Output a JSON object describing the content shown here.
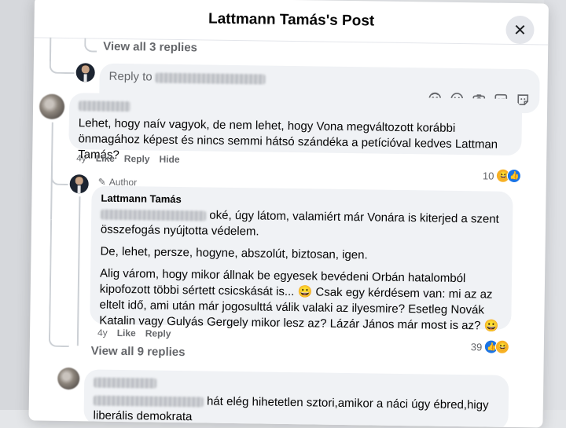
{
  "modal": {
    "title": "Lattmann Tamás's Post",
    "close_icon": "close-icon"
  },
  "top_thread": {
    "view_replies": "View all 3 replies"
  },
  "reply_box": {
    "placeholder_prefix": "Reply to",
    "icons": [
      "avatar-sticker-icon",
      "emoji-icon",
      "camera-icon",
      "gif-icon",
      "sticker-icon"
    ]
  },
  "comment1": {
    "text": "Lehet, hogy naív vagyok, de nem lehet, hogy Vona megváltozott korábbi önmagához képest és nincs semmi hátsó szándéka a petícióval kedves Lattman Tamás?",
    "time": "4y",
    "like": "Like",
    "reply": "Reply",
    "hide": "Hide",
    "reaction_count": "10"
  },
  "author_reply": {
    "badge": "Author",
    "name": "Lattmann Tamás",
    "p1_suffix": " oké, úgy látom, valamiért már Vonára is kiterjed a szent összefogás nyújtotta védelem.",
    "p2": "De, lehet, persze, hogyne, abszolút, biztosan, igen.",
    "p3": "Alig várom, hogy mikor állnak be egyesek bevédeni Orbán hatalomból kipofozott többi sértett csicskását is... 😀 Csak egy kérdésem van: mi az az eltelt idő, ami után már jogosulttá válik valaki az ilyesmire? Esetleg Novák Katalin vagy Gulyás Gergely mikor lesz az? Lázár János már most is az? 😀",
    "time": "4y",
    "like": "Like",
    "reply": "Reply",
    "reaction_count": "39",
    "view_replies": "View all 9 replies"
  },
  "comment3": {
    "text_suffix": " hát elég hihetetlen sztori,amikor a náci úgy ébred,higy liberális demokrata"
  },
  "colors": {
    "bubble": "#f0f2f5",
    "secondary_text": "#65676b",
    "like_blue": "#1b74e4",
    "haha_yellow": "#f7b125"
  }
}
